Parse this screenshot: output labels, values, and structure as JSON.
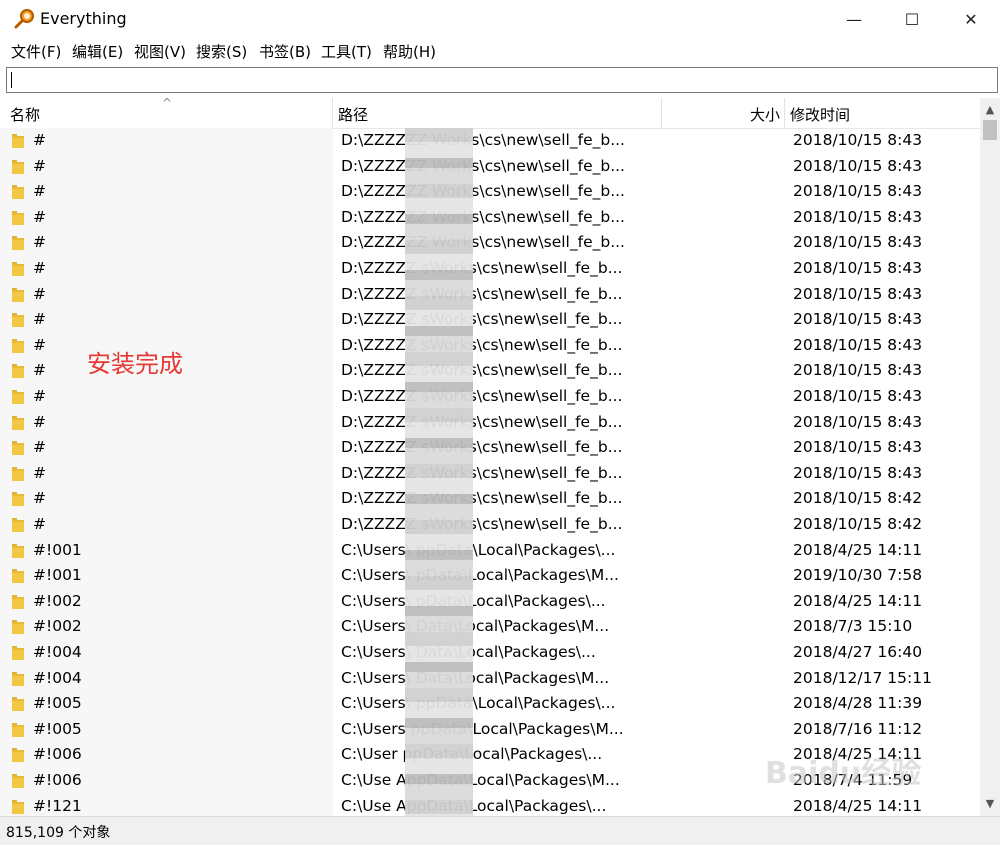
{
  "window": {
    "title": "Everything",
    "minimize": "—",
    "maximize": "☐",
    "close": "✕"
  },
  "menu": [
    "文件(F)",
    "编辑(E)",
    "视图(V)",
    "搜索(S)",
    "书签(B)",
    "工具(T)",
    "帮助(H)"
  ],
  "search": {
    "value": ""
  },
  "columns": {
    "name": "名称",
    "path": "路径",
    "size": "大小",
    "modified": "修改时间"
  },
  "rows": [
    {
      "name": "#",
      "path": "D:\\ZZZZZZ      Works\\cs\\new\\sell_fe_b...",
      "date": "2018/10/15 8:43"
    },
    {
      "name": "#",
      "path": "D:\\ZZZZZZ      Works\\cs\\new\\sell_fe_b...",
      "date": "2018/10/15 8:43"
    },
    {
      "name": "#",
      "path": "D:\\ZZZZZZ      Works\\cs\\new\\sell_fe_b...",
      "date": "2018/10/15 8:43"
    },
    {
      "name": "#",
      "path": "D:\\ZZZZZZ      Works\\cs\\new\\sell_fe_b...",
      "date": "2018/10/15 8:43"
    },
    {
      "name": "#",
      "path": "D:\\ZZZZZZ      Works\\cs\\new\\sell_fe_b...",
      "date": "2018/10/15 8:43"
    },
    {
      "name": "#",
      "path": "D:\\ZZZZZ      sWorks\\cs\\new\\sell_fe_b...",
      "date": "2018/10/15 8:43"
    },
    {
      "name": "#",
      "path": "D:\\ZZZZZ      sWorks\\cs\\new\\sell_fe_b...",
      "date": "2018/10/15 8:43"
    },
    {
      "name": "#",
      "path": "D:\\ZZZZZ      sWorks\\cs\\new\\sell_fe_b...",
      "date": "2018/10/15 8:43"
    },
    {
      "name": "#",
      "path": "D:\\ZZZZZ      sWorks\\cs\\new\\sell_fe_b...",
      "date": "2018/10/15 8:43"
    },
    {
      "name": "#",
      "path": "D:\\ZZZZZ      sWorks\\cs\\new\\sell_fe_b...",
      "date": "2018/10/15 8:43"
    },
    {
      "name": "#",
      "path": "D:\\ZZZZZ      sWorks\\cs\\new\\sell_fe_b...",
      "date": "2018/10/15 8:43"
    },
    {
      "name": "#",
      "path": "D:\\ZZZZZ      sWorks\\cs\\new\\sell_fe_b...",
      "date": "2018/10/15 8:43"
    },
    {
      "name": "#",
      "path": "D:\\ZZZZZ      sWorks\\cs\\new\\sell_fe_b...",
      "date": "2018/10/15 8:43"
    },
    {
      "name": "#",
      "path": "D:\\ZZZZZ      sWorks\\cs\\new\\sell_fe_b...",
      "date": "2018/10/15 8:43"
    },
    {
      "name": "#",
      "path": "D:\\ZZZZZ      sWorks\\cs\\new\\sell_fe_b...",
      "date": "2018/10/15 8:42"
    },
    {
      "name": "#",
      "path": "D:\\ZZZZZ      sWorks\\cs\\new\\sell_fe_b...",
      "date": "2018/10/15 8:42"
    },
    {
      "name": "#!001",
      "path": "C:\\Users\\      ppData\\Local\\Packages\\...",
      "date": "2018/4/25 14:11"
    },
    {
      "name": "#!001",
      "path": "C:\\Users\\      pData\\Local\\Packages\\M...",
      "date": "2019/10/30 7:58"
    },
    {
      "name": "#!002",
      "path": "C:\\Users\\      pData\\Local\\Packages\\...",
      "date": "2018/4/25 14:11"
    },
    {
      "name": "#!002",
      "path": "C:\\Users\\      Data\\Local\\Packages\\M...",
      "date": "2018/7/3 15:10"
    },
    {
      "name": "#!004",
      "path": "C:\\Users\\      Data\\Local\\Packages\\...",
      "date": "2018/4/27 16:40"
    },
    {
      "name": "#!004",
      "path": "C:\\Users\\      Data\\Local\\Packages\\M...",
      "date": "2018/12/17 15:11"
    },
    {
      "name": "#!005",
      "path": "C:\\Users\\      ppData\\Local\\Packages\\...",
      "date": "2018/4/28 11:39"
    },
    {
      "name": "#!005",
      "path": "C:\\Users      ppData\\Local\\Packages\\M...",
      "date": "2018/7/16 11:12"
    },
    {
      "name": "#!006",
      "path": "C:\\User      ppData\\Local\\Packages\\...",
      "date": "2018/4/25 14:11"
    },
    {
      "name": "#!006",
      "path": "C:\\Use      AppData\\Local\\Packages\\M...",
      "date": "2018/7/4 11:59"
    },
    {
      "name": "#!121",
      "path": "C:\\Use      AppData\\Local\\Packages\\...",
      "date": "2018/4/25 14:11"
    }
  ],
  "annotation": "安装完成",
  "status": "815,109 个对象",
  "watermark": "Baidu经验",
  "colors": {
    "annotation": "#e53935",
    "folder": "#f2c744"
  }
}
